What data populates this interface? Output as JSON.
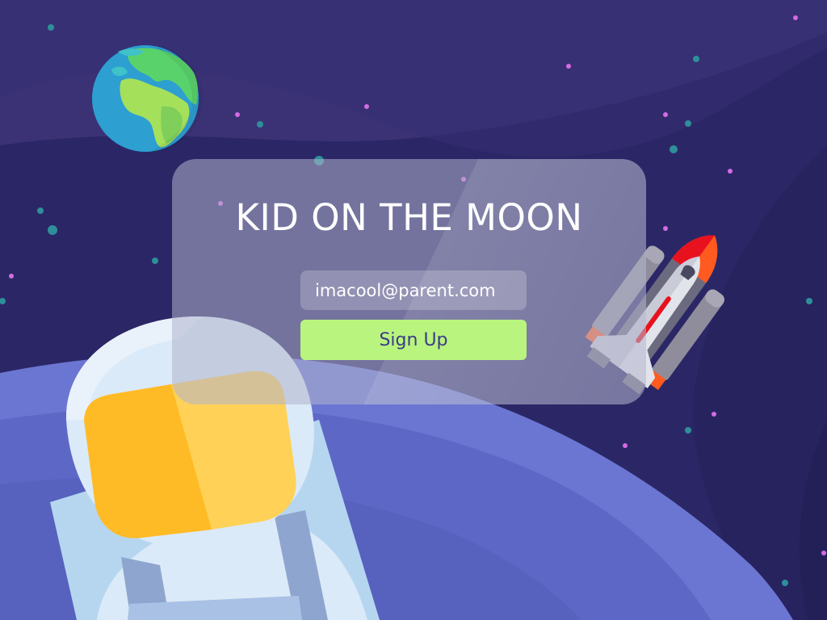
{
  "app": {
    "title": "KID ON THE MOON"
  },
  "signup_form": {
    "email_value": "imacool@parent.com",
    "email_placeholder": "",
    "submit_label": "Sign Up"
  },
  "theme": {
    "sky": "#2b2766",
    "planet": "#6470cc",
    "button": "#b9f47e",
    "button_text": "#3a3c87",
    "visor": "#ffc43a"
  },
  "illustration": {
    "items": [
      "earth-icon",
      "astronaut-icon",
      "space-shuttle-icon",
      "planet-surface",
      "stars"
    ]
  }
}
